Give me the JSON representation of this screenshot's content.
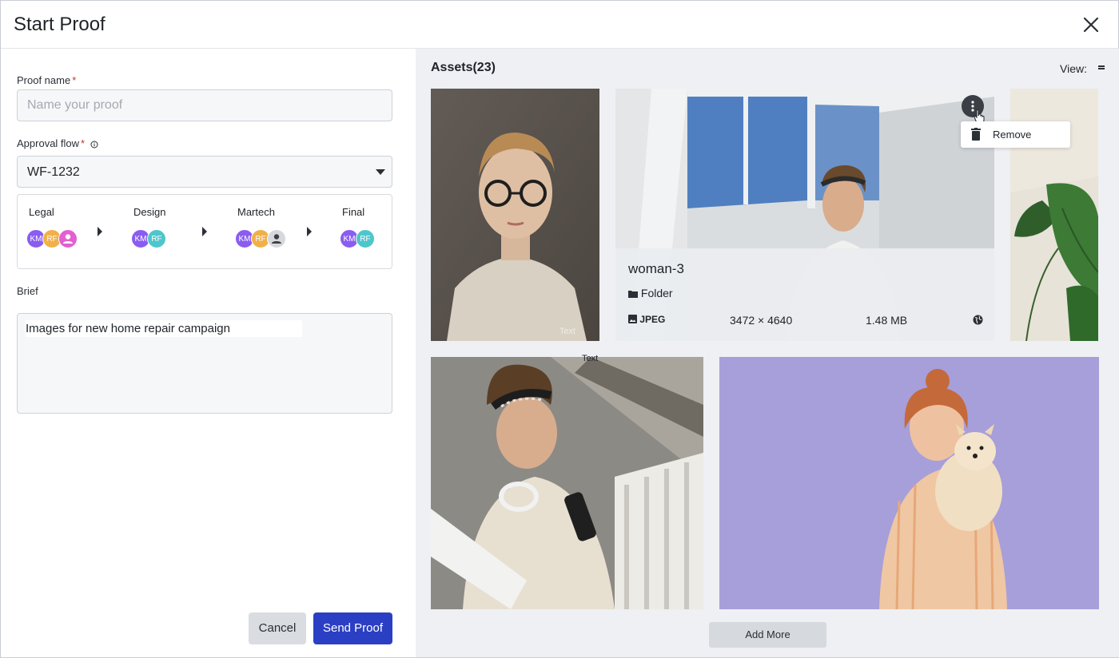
{
  "dialog": {
    "title": "Start Proof"
  },
  "form": {
    "proof_name_label": "Proof name",
    "required_mark": "*",
    "proof_name_placeholder": "Name your proof",
    "proof_name_value": "",
    "approval_flow_label": "Approval flow",
    "approval_flow_value": "WF-1232",
    "stages": [
      {
        "name": "Legal",
        "avatars": [
          "KM",
          "RF",
          "user-icon"
        ]
      },
      {
        "name": "Design",
        "avatars": [
          "KM",
          "RF"
        ]
      },
      {
        "name": "Martech",
        "avatars": [
          "KM",
          "RF",
          "user-icon"
        ]
      },
      {
        "name": "Final",
        "avatars": [
          "KM",
          "RF"
        ]
      }
    ],
    "brief_label": "Brief",
    "brief_value": "Images for new home repair campaign",
    "cancel_label": "Cancel",
    "send_label": "Send Proof"
  },
  "assets": {
    "title": "Assets(23)",
    "view_label": "View:",
    "selected": {
      "name": "woman-3",
      "folder": "Folder",
      "type": "JPEG",
      "dimensions": "3472 × 4640",
      "size": "1.48 MB"
    },
    "menu": {
      "remove_label": "Remove"
    },
    "floating_text": "Text",
    "watermark_text": "Text",
    "add_more_label": "Add More"
  },
  "colors": {
    "primary": "#2b3fc4",
    "avatar_purple": "#8a5cf0",
    "avatar_orange": "#f0b04a",
    "avatar_pink": "#e45fd0",
    "avatar_teal": "#4ec6cb",
    "panel_bg": "#eef0f3"
  }
}
